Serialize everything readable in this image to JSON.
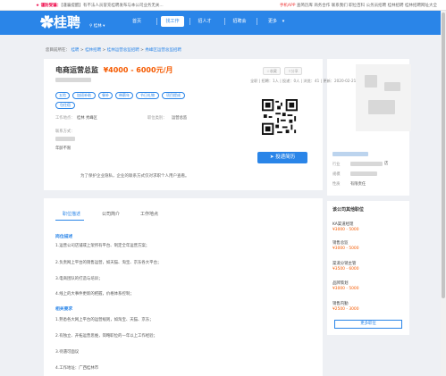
{
  "topbar": {
    "notice_label": "★ 谨防受骗：",
    "notice_text": "【谨骗提醒】有不法人员冒充桂聘发布与本公司业务无关...",
    "app_link": "手机APP",
    "links": [
      "查简历库",
      "商务合作",
      "联系我们",
      "职位百科",
      "公务员招聘",
      "桂林招聘",
      "桂林招聘网址大全"
    ]
  },
  "header": {
    "logo": "桂聘",
    "location": "桂林",
    "nav": [
      "首页",
      "找工作",
      "招人才",
      "招聘会",
      "更多"
    ],
    "active_nav": "找工作"
  },
  "breadcrumb": {
    "prefix": "您目前所在：",
    "items": [
      "桂聘",
      "桂林招聘",
      "桂林运营总监招聘",
      "秀峰区运营总监招聘"
    ]
  },
  "job": {
    "title": "电商运营总监",
    "salary": "¥4000 - 6000元/月",
    "collect_label": "收藏",
    "share_label": "分享",
    "meta": "全职 | 招聘：1人 | 投递：0人 | 浏览：41 | 更新：2020-02-21 09:09",
    "tags": [
      "五险",
      "加班补助",
      "餐补",
      "带薪年",
      "节日礼物",
      "项目提成",
      "包住宿"
    ],
    "work_location_label": "工作地点：",
    "work_location": "桂林 秀峰区",
    "category_label": "职位类别：",
    "category": "运营总监",
    "contact_label": "联系方式：",
    "age_label": "年龄不限",
    "apply_label": "投递简历",
    "privacy_note": "为了保护企业隐私，企业的联系方式仅对求职个人用户查看。"
  },
  "tabs": [
    "职位描述",
    "公司简介",
    "工作地点"
  ],
  "description": {
    "duties_heading": "岗位描述",
    "duties": [
      "1.运营公司店铺或上架所有平台、制定全年运营方案；",
      "2.负责网上平台的销售运营，如天猫、淘宝、京东各大平台；",
      "3.电商团队的打造与培训；",
      "4.线上的大事件更新的把握，价格体系控制；"
    ],
    "req_heading": "相关要求",
    "requirements": [
      "1.熟悉各大网上平台的运营规则，如淘宝、天猫、京东；",
      "2.有独立、开拓运营思维，简略职位的一年以上工作经验；",
      "3.待遇可面议",
      "4.工作地址：广西桂林市"
    ]
  },
  "company": {
    "industry_label": "行业",
    "size_label": "规模",
    "nature_label": "性质",
    "nature": "有限责任",
    "suffix": "店"
  },
  "sidebar": {
    "heading": "该公司其他职位",
    "jobs": [
      {
        "title": "KA渠道经理",
        "salary": "¥3000 - 5000"
      },
      {
        "title": "销售总监",
        "salary": "¥3000 - 5000"
      },
      {
        "title": "渠道分销主管",
        "salary": "¥3500 - 6000"
      },
      {
        "title": "品牌策划",
        "salary": "¥3000 - 5000"
      },
      {
        "title": "销售内勤",
        "salary": "¥2500 - 3000"
      }
    ],
    "more_label": "更多职位"
  },
  "colors": {
    "brand": "#2a85e8",
    "salary": "#f55a00"
  }
}
